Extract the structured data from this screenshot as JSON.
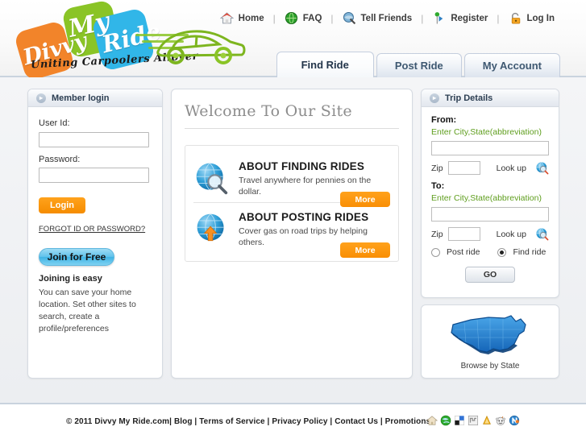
{
  "brand": {
    "word1": "Divvy",
    "word2": "My",
    "word3": "Ride",
    "tagline": "Uniting Carpoolers Allover",
    "colors": {
      "orange": "#f2842a",
      "green": "#8ac426",
      "blue": "#31b6e8"
    }
  },
  "topnav": {
    "items": [
      {
        "label": "Home",
        "icon": "house-icon"
      },
      {
        "label": "FAQ",
        "icon": "green-globe-icon"
      },
      {
        "label": "Tell Friends",
        "icon": "tell-friends-icon"
      },
      {
        "label": "Register",
        "icon": "register-pin-icon"
      },
      {
        "label": "Log In",
        "icon": "padlock-icon"
      }
    ],
    "separator": "|"
  },
  "tabs": [
    {
      "label": "Find Ride",
      "active": true
    },
    {
      "label": "Post Ride",
      "active": false
    },
    {
      "label": "My Account",
      "active": false
    }
  ],
  "member_login": {
    "title": "Member login",
    "user_label": "User Id:",
    "user_value": "",
    "password_label": "Password:",
    "password_value": "",
    "login_button": "Login",
    "forgot_link": "FORGOT ID OR PASSWORD?",
    "join_button": "Join for Free",
    "join_title": "Joining is easy",
    "join_text": "You can save your home location. Set other sites to search, create a profile/preferences"
  },
  "welcome": {
    "heading": "Welcome To Our Site",
    "features": [
      {
        "title": "ABOUT FINDING RIDES",
        "desc": "Travel anywhere for pennies on the dollar.",
        "button": "More",
        "icon": "globe-magnifier-icon"
      },
      {
        "title": "ABOUT POSTING RIDES",
        "desc": "Cover gas on road trips by helping others.",
        "button": "More",
        "icon": "globe-upload-icon"
      }
    ]
  },
  "trip_details": {
    "title": "Trip Details",
    "from_label": "From:",
    "from_hint": "Enter City,State(abbreviation)",
    "from_value": "",
    "from_zip_label": "Zip",
    "from_zip_value": "",
    "from_lookup": "Look up",
    "to_label": "To:",
    "to_hint": "Enter City,State(abbreviation)",
    "to_value": "",
    "to_zip_label": "Zip",
    "to_zip_value": "",
    "to_lookup": "Look up",
    "radio_post": "Post ride",
    "radio_find": "Find ride",
    "selected_radio": "Find ride",
    "go_button": "GO"
  },
  "map": {
    "caption": "Browse by State",
    "icon": "us-map-icon"
  },
  "footer": {
    "text": "© 2011 Divvy My Ride.com| Blog | Terms of Service | Privacy Policy | Contact Us | Promotions",
    "social_icons": [
      "home-bookmark-icon",
      "technorati-globe-icon",
      "delicious-icon",
      "stumbleupon-icon",
      "digg-icon",
      "reddit-icon",
      "newsvine-icon"
    ]
  }
}
